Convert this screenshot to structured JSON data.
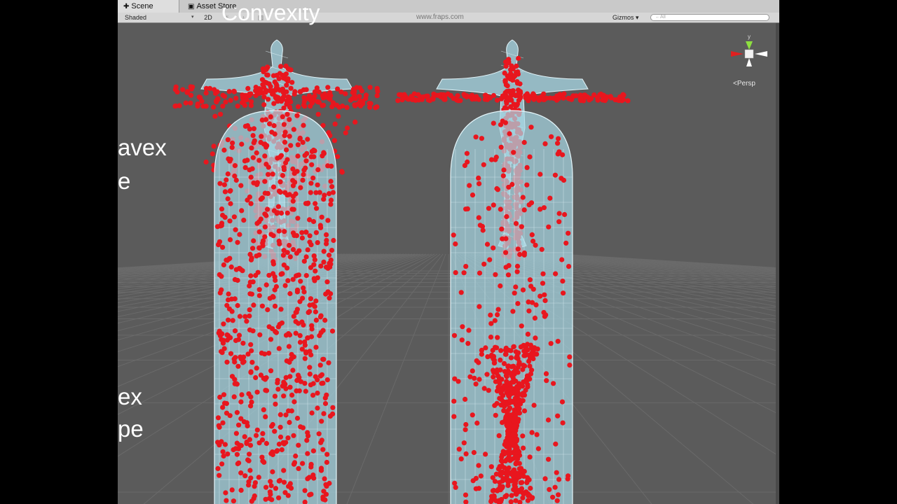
{
  "tabs": {
    "scene": {
      "icon": "scene-icon",
      "label": "Scene"
    },
    "asset_store": {
      "icon": "asset-store-icon",
      "label": "Asset Store"
    }
  },
  "toolbar": {
    "draw_mode": "Shaded",
    "mode_2d": "2D",
    "gizmos": "Gizmos",
    "search_placeholder": "←All",
    "watermark": "www.fraps.com"
  },
  "scene": {
    "title": "Convexity",
    "labels": [
      "avex",
      "e",
      "ex",
      "pe"
    ],
    "orientation_gizmo": {
      "axis_y": "y",
      "projection": "Persp"
    }
  },
  "colors": {
    "background": "#5b5b5b",
    "grid": "#6a6a6a",
    "mesh_fill": "#a8d8e6",
    "wire": "#e4f6fb",
    "points": "#e8161e",
    "axis_x": "#e02020",
    "axis_y": "#8ee040",
    "axis_z": "#ffffff"
  }
}
